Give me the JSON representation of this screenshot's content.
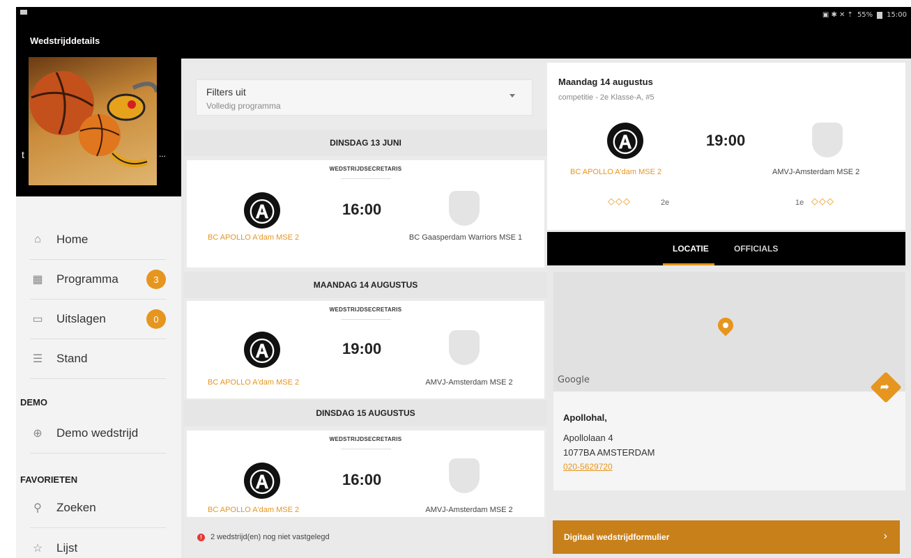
{
  "status_bar": {
    "battery": "55%",
    "time": "15:00"
  },
  "app": {
    "title": "Wedstrijddetails"
  },
  "sidebar": {
    "header_truncated_left": "t",
    "header_truncated_right": "...",
    "items": [
      {
        "label": "Home",
        "icon": "home-icon"
      },
      {
        "label": "Programma",
        "icon": "calendar-icon",
        "badge": "3"
      },
      {
        "label": "Uitslagen",
        "icon": "scoreboard-icon",
        "badge": "0"
      },
      {
        "label": "Stand",
        "icon": "list-icon"
      }
    ],
    "section_demo": "DEMO",
    "demo_item": {
      "label": "Demo wedstrijd",
      "icon": "play-circle-icon"
    },
    "section_favorites": "FAVORIETEN",
    "fav_items": [
      {
        "label": "Zoeken",
        "icon": "search-icon"
      },
      {
        "label": "Lijst",
        "icon": "star-icon"
      }
    ]
  },
  "filter": {
    "title": "Filters uit",
    "subtitle": "Volledig programma"
  },
  "schedule": [
    {
      "date": "DINSDAG 13 JUNI",
      "role": "WEDSTRIJDSECRETARIS",
      "time": "16:00",
      "home": "BC APOLLO A'dam MSE 2",
      "away": "BC Gaasperdam Warriors MSE 1"
    },
    {
      "date": "MAANDAG 14 AUGUSTUS",
      "role": "WEDSTRIJDSECRETARIS",
      "time": "19:00",
      "home": "BC APOLLO A'dam MSE 2",
      "away": "AMVJ-Amsterdam MSE 2"
    },
    {
      "date": "DINSDAG 15 AUGUSTUS",
      "role": "WEDSTRIJDSECRETARIS",
      "time": "16:00",
      "home": "BC APOLLO A'dam MSE 2",
      "away": "AMVJ-Amsterdam MSE 2"
    }
  ],
  "warning": {
    "icon": "!",
    "text": "2 wedstrijd(en) nog niet vastgelegd"
  },
  "detail": {
    "date": "Maandag 14 augustus",
    "competition": "competitie - 2e Klasse-A, #5",
    "time": "19:00",
    "home": "BC APOLLO A'dam MSE 2",
    "away": "AMVJ-Amsterdam MSE 2",
    "home_rank": "2e",
    "away_rank": "1e",
    "diamonds": "◇◇◇",
    "tabs": [
      "LOCATIE",
      "OFFICIALS"
    ],
    "map_attribution": "Google",
    "venue": "Apollohal,",
    "street": "Apollolaan 4",
    "city": "1077BA AMSTERDAM",
    "phone": "020-5629720",
    "form_button": "Digitaal wedstrijdformulier",
    "form_chevron": "›"
  },
  "colors": {
    "accent": "#e6951f",
    "header": "#000000",
    "form_button": "#c8801a"
  }
}
